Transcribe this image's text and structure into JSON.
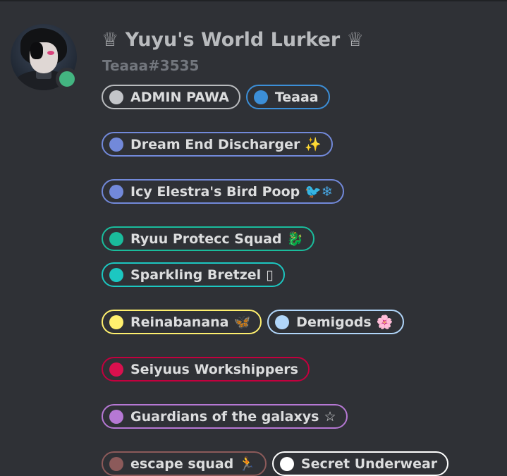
{
  "profile": {
    "username": "♕ Yuyu's World Lurker ♕",
    "tag": "Teaaa#3535",
    "status": "online",
    "status_color": "#43b581"
  },
  "roles": [
    {
      "name": "ADMIN PAWA",
      "color": "#b9bbbe",
      "dot": "#c3c5c9",
      "emoji": ""
    },
    {
      "name": "Teaaa",
      "color": "#3c8fd8",
      "dot": "#3c8fd8",
      "emoji": ""
    },
    {
      "name": "Dream End Discharger",
      "color": "#7289da",
      "dot": "#7289da",
      "emoji": "✨",
      "emoji_color": "#f3b23a"
    },
    {
      "name": "Icy Elestra's Bird Poop",
      "color": "#7289da",
      "dot": "#7289da",
      "emoji": "🐦❄",
      "emoji_color": "#48a9e6"
    },
    {
      "name": "Ryuu Protecc Squad",
      "color": "#1abc9c",
      "dot": "#1abc9c",
      "emoji": "🐉",
      "emoji_color": "#77b255"
    },
    {
      "name": "Sparkling Bretzel",
      "color": "#1cc7c1",
      "dot": "#1cc7c1",
      "emoji": "▯",
      "emoji_color": "#dcddde"
    },
    {
      "name": "Reinabanana",
      "color": "#fff06e",
      "dot": "#fff06e",
      "emoji": "🦋",
      "emoji_color": "#f4a340"
    },
    {
      "name": "Demigods",
      "color": "#b1d6fa",
      "dot": "#b1d6fa",
      "emoji": "🌸",
      "emoji_color": "#f48fb1"
    },
    {
      "name": "Seiyuus Workshippers",
      "color": "#c3003e",
      "dot": "#d9104e",
      "emoji": ""
    },
    {
      "name": "Guardians of the galaxys",
      "color": "#b678d4",
      "dot": "#b678d4",
      "emoji": "☆",
      "emoji_color": "#dcddde"
    },
    {
      "name": "escape squad",
      "color": "#8c5a5a",
      "dot": "#8c5a5a",
      "emoji": "🏃",
      "emoji_color": "#f5c400"
    },
    {
      "name": "Secret Underwear",
      "color": "#ffffff",
      "dot": "#ffffff",
      "emoji": ""
    }
  ]
}
